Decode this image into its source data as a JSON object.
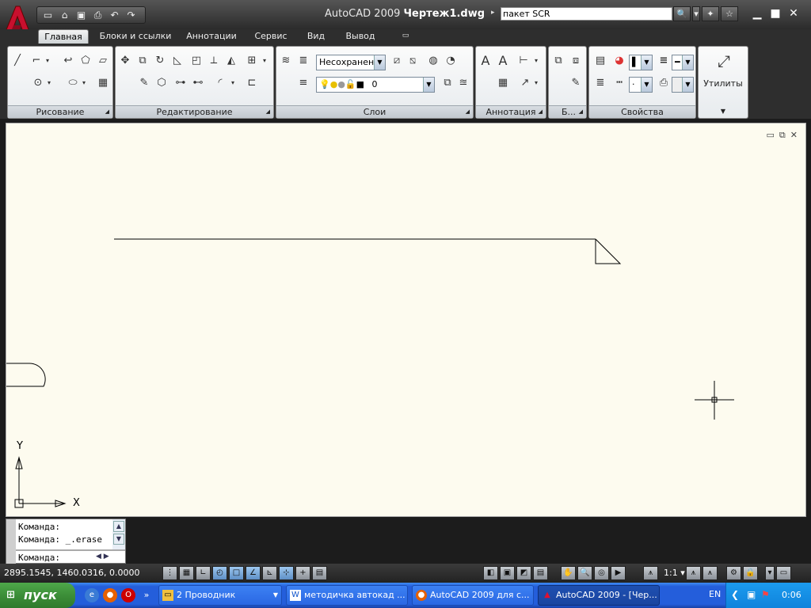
{
  "titlebar": {
    "app": "AutoCAD 2009",
    "document": "Чертеж1.dwg",
    "search_value": "пакет SCR"
  },
  "ribbon_tabs": [
    "Главная",
    "Блоки и ссылки",
    "Аннотации",
    "Сервис",
    "Вид",
    "Вывод"
  ],
  "panels": {
    "draw": "Рисование",
    "modify": "Редактирование",
    "layers": "Слои",
    "annotation": "Аннотация",
    "block": "Б...",
    "properties": "Свойства",
    "utilities": "Утилиты"
  },
  "layers": {
    "state_combo": "Несохраненн",
    "current_layer": "0"
  },
  "ucs": {
    "x_label": "X",
    "y_label": "Y"
  },
  "command": {
    "history": [
      "Команда:",
      "Команда: _.erase"
    ],
    "prompt": "Команда:"
  },
  "status": {
    "coordinates": "2895.1545, 1460.0316, 0.0000",
    "annotation_scale": "1:1"
  },
  "taskbar": {
    "start_label": "пуск",
    "buttons": [
      "2 Проводник",
      "методичка автокад ...",
      "AutoCAD 2009 для с...",
      "AutoCAD 2009 - [Чер..."
    ],
    "language": "EN",
    "clock": "0:06"
  },
  "colors": {
    "canvas": "#fdfbef",
    "chrome": "#2e2e2e",
    "accent_red": "#c8102e",
    "taskbar": "#245edb",
    "start": "#3c8e38"
  }
}
